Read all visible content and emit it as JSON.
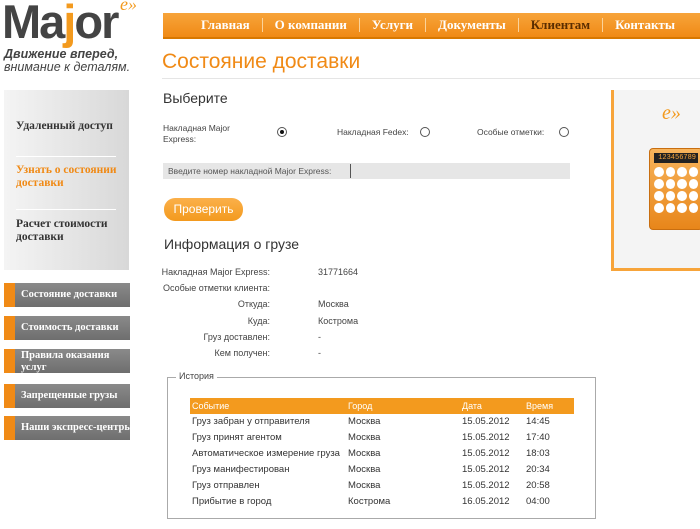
{
  "logo": {
    "brand_left": "Ma",
    "brand_j": "j",
    "brand_right": "or",
    "mark": "e»",
    "tagline1": "Движение вперед,",
    "tagline2": "внимание к деталям."
  },
  "nav": [
    "Главная",
    "О компании",
    "Услуги",
    "Документы",
    "Клиентам",
    "Контакты"
  ],
  "page_title": "Состояние доставки",
  "sidebar": {
    "links": [
      "Удаленный доступ",
      "Узнать о состоянии доставки",
      "Расчет стоимости доставки"
    ],
    "menu": [
      "Состояние доставки",
      "Стоимость доставки",
      "Правила оказания услуг",
      "Запрещенные грузы",
      "Наши экспресс-центры"
    ]
  },
  "banner": {
    "mark": "e»",
    "calc_display": "123456789"
  },
  "select": {
    "title": "Выберите",
    "options": [
      "Накладная Major Express:",
      "Накладная Fedex:",
      "Особые отметки:"
    ],
    "selected_index": 0
  },
  "track": {
    "label": "Введите номер накладной Major Express:",
    "value": ""
  },
  "check_button": "Проверить",
  "info": {
    "title": "Информация о грузе",
    "rows": [
      {
        "k": "Накладная Major Express:",
        "v": "31771664"
      },
      {
        "k": "Особые отметки клиента:",
        "v": ""
      },
      {
        "k": "Откуда:",
        "v": "Москва"
      },
      {
        "k": "Куда:",
        "v": "Кострома"
      },
      {
        "k": "Груз доставлен:",
        "v": "-"
      },
      {
        "k": "Кем получен:",
        "v": "-"
      }
    ]
  },
  "history": {
    "legend": "История",
    "headers": [
      "Событие",
      "Город",
      "Дата",
      "Время"
    ],
    "rows": [
      [
        "Груз забран у отправителя",
        "Москва",
        "15.05.2012",
        "14:45"
      ],
      [
        "Груз принят агентом",
        "Москва",
        "15.05.2012",
        "17:40"
      ],
      [
        "Автоматическое измерение груза",
        "Москва",
        "15.05.2012",
        "18:03"
      ],
      [
        "Груз манифестирован",
        "Москва",
        "15.05.2012",
        "20:34"
      ],
      [
        "Груз отправлен",
        "Москва",
        "15.05.2012",
        "20:58"
      ],
      [
        "Прибытие в город",
        "Кострома",
        "16.05.2012",
        "04:00"
      ]
    ]
  },
  "colors": {
    "accent": "#f08a16",
    "sidebar_gray": "#7a7a7a"
  }
}
